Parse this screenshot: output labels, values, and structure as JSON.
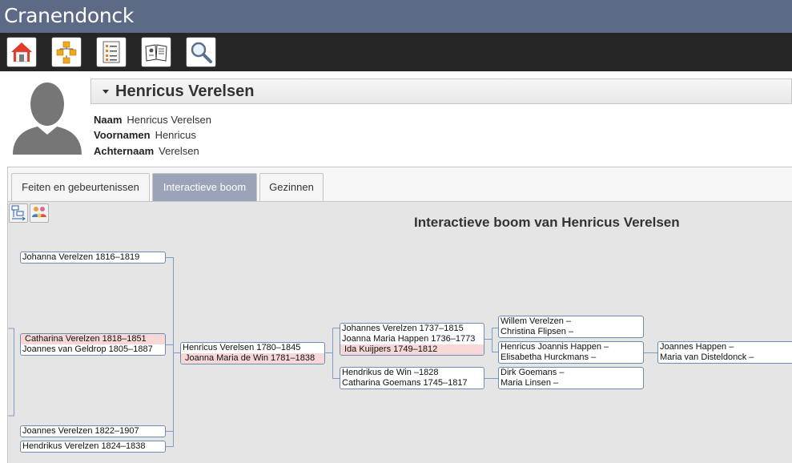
{
  "app": {
    "title": "Cranendonck"
  },
  "toolbar": {
    "buttons": [
      {
        "icon": "home-icon"
      },
      {
        "icon": "family-tree-icon"
      },
      {
        "icon": "list-icon"
      },
      {
        "icon": "book-icon"
      },
      {
        "icon": "search-icon"
      }
    ]
  },
  "person": {
    "name": "Henricus Verelsen",
    "facts": [
      {
        "label": "Naam",
        "value": "Henricus Verelsen"
      },
      {
        "label": "Voornamen",
        "value": "Henricus"
      },
      {
        "label": "Achternaam",
        "value": "Verelsen"
      }
    ]
  },
  "tabs": [
    {
      "label": "Feiten en gebeurtenissen",
      "active": false
    },
    {
      "label": "Interactieve boom",
      "active": true
    },
    {
      "label": "Gezinnen",
      "active": false
    }
  ],
  "tree": {
    "title": "Interactieve boom van Henricus Verelsen",
    "children": [
      {
        "line1": "Johanna Verelzen 1816–1819"
      },
      {
        "line1": "Catharina Verelzen 1818–1851",
        "line2": "Joannes van Geldrop 1805–1887"
      },
      {
        "line1": "Joannes Verelzen 1822–1907"
      },
      {
        "line1": "Hendrikus Verelzen 1824–1838"
      }
    ],
    "root": {
      "line1": "Henricus Verelsen 1780–1845",
      "line2": "Joanna Maria de Win 1781–1838"
    },
    "parents": [
      {
        "line1": "Johannes Verelzen 1737–1815",
        "line2": "Joanna Maria Happen 1736–1773",
        "line3": "Ida Kuijpers 1749–1812"
      },
      {
        "line1": "Hendrikus de Win –1828",
        "line2": "Catharina Goemans 1745–1817"
      }
    ],
    "grandparents": [
      {
        "line1": "Willem Verelzen –",
        "line2": "Christina Flipsen –"
      },
      {
        "line1": "Henricus Joannis Happen –",
        "line2": "Elisabetha Hurckmans –"
      },
      {
        "line1": "Dirk Goemans –",
        "line2": "Maria Linsen –"
      }
    ],
    "great_grandparents": [
      {
        "line1": "Joannes Happen –",
        "line2": "Maria van Disteldonck –"
      }
    ]
  },
  "colors": {
    "titlebar": "#5d6a86",
    "toolbar": "#262626",
    "active_tab": "#9aa3b8",
    "box_border": "#6d8cb2",
    "spouse_highlight": "#f8d7d7"
  }
}
